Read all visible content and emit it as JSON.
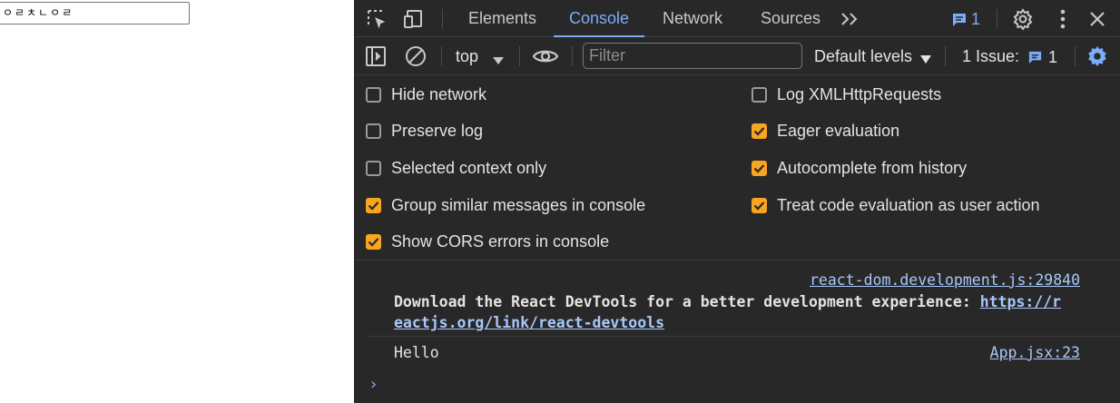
{
  "page": {
    "input_value": "ㅇㄹㅊㄴㅇㄹ"
  },
  "tabbar": {
    "tabs": [
      "Elements",
      "Console",
      "Network",
      "Sources"
    ],
    "more_tabs_label": ">>",
    "issues_count": "1"
  },
  "toolbar": {
    "context": "top",
    "filter_placeholder": "Filter",
    "levels": "Default levels",
    "issue_label": "1 Issue:",
    "issue_count": "1"
  },
  "settings": {
    "left": [
      {
        "label": "Hide network",
        "checked": false
      },
      {
        "label": "Preserve log",
        "checked": false
      },
      {
        "label": "Selected context only",
        "checked": false
      },
      {
        "label": "Group similar messages in console",
        "checked": true
      },
      {
        "label": "Show CORS errors in console",
        "checked": true
      }
    ],
    "right": [
      {
        "label": "Log XMLHttpRequests",
        "checked": false
      },
      {
        "label": "Eager evaluation",
        "checked": true
      },
      {
        "label": "Autocomplete from history",
        "checked": true
      },
      {
        "label": "Treat code evaluation as user action",
        "checked": true
      }
    ]
  },
  "console": {
    "messages": [
      {
        "source": "react-dom.development.js:29840",
        "text_line1": "Download the React DevTools for a better development experience: ",
        "link_part1": "https://r",
        "link_part2": "eactjs.org/link/react-devtools"
      },
      {
        "source": "App.jsx:23",
        "text": "Hello"
      }
    ],
    "prompt": "›"
  },
  "colors": {
    "accent": "#7cacf8",
    "checkbox_on": "#f8a520",
    "panel_bg": "#282828"
  }
}
